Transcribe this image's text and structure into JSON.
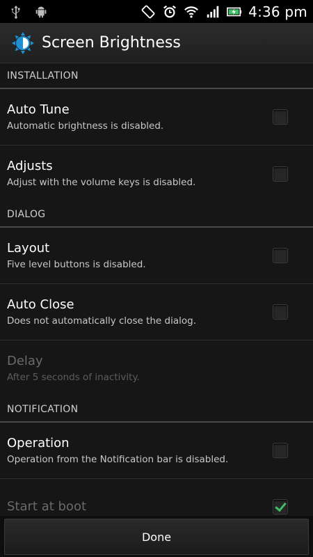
{
  "status_bar": {
    "time": "4:36 pm",
    "left_icons": [
      "usb-icon",
      "android-debug-icon"
    ],
    "right_icons": [
      "screen-rotation-icon",
      "alarm-icon",
      "wifi-icon",
      "signal-icon",
      "battery-charging-icon"
    ]
  },
  "action_bar": {
    "title": "Screen Brightness",
    "icon": "brightness-app-icon",
    "accent_color": "#1e90d6"
  },
  "sections": [
    {
      "header": "INSTALLATION",
      "items": [
        {
          "title": "Auto Tune",
          "summary": "Automatic brightness is disabled.",
          "checked": false,
          "enabled": true
        },
        {
          "title": "Adjusts",
          "summary": "Adjust with the volume keys is disabled.",
          "checked": false,
          "enabled": true
        }
      ]
    },
    {
      "header": "DIALOG",
      "items": [
        {
          "title": "Layout",
          "summary": "Five level buttons is disabled.",
          "checked": false,
          "enabled": true
        },
        {
          "title": "Auto Close",
          "summary": "Does not automatically close the dialog.",
          "checked": false,
          "enabled": true
        },
        {
          "title": "Delay",
          "summary": "After 5 seconds of inactivity.",
          "enabled": false
        }
      ]
    },
    {
      "header": "NOTIFICATION",
      "items": [
        {
          "title": "Operation",
          "summary": "Operation from the Notification bar is disabled.",
          "checked": false,
          "enabled": true
        },
        {
          "title": "Start at boot",
          "summary": "",
          "checked": true,
          "enabled": false
        }
      ]
    }
  ],
  "footer": {
    "done_label": "Done"
  }
}
